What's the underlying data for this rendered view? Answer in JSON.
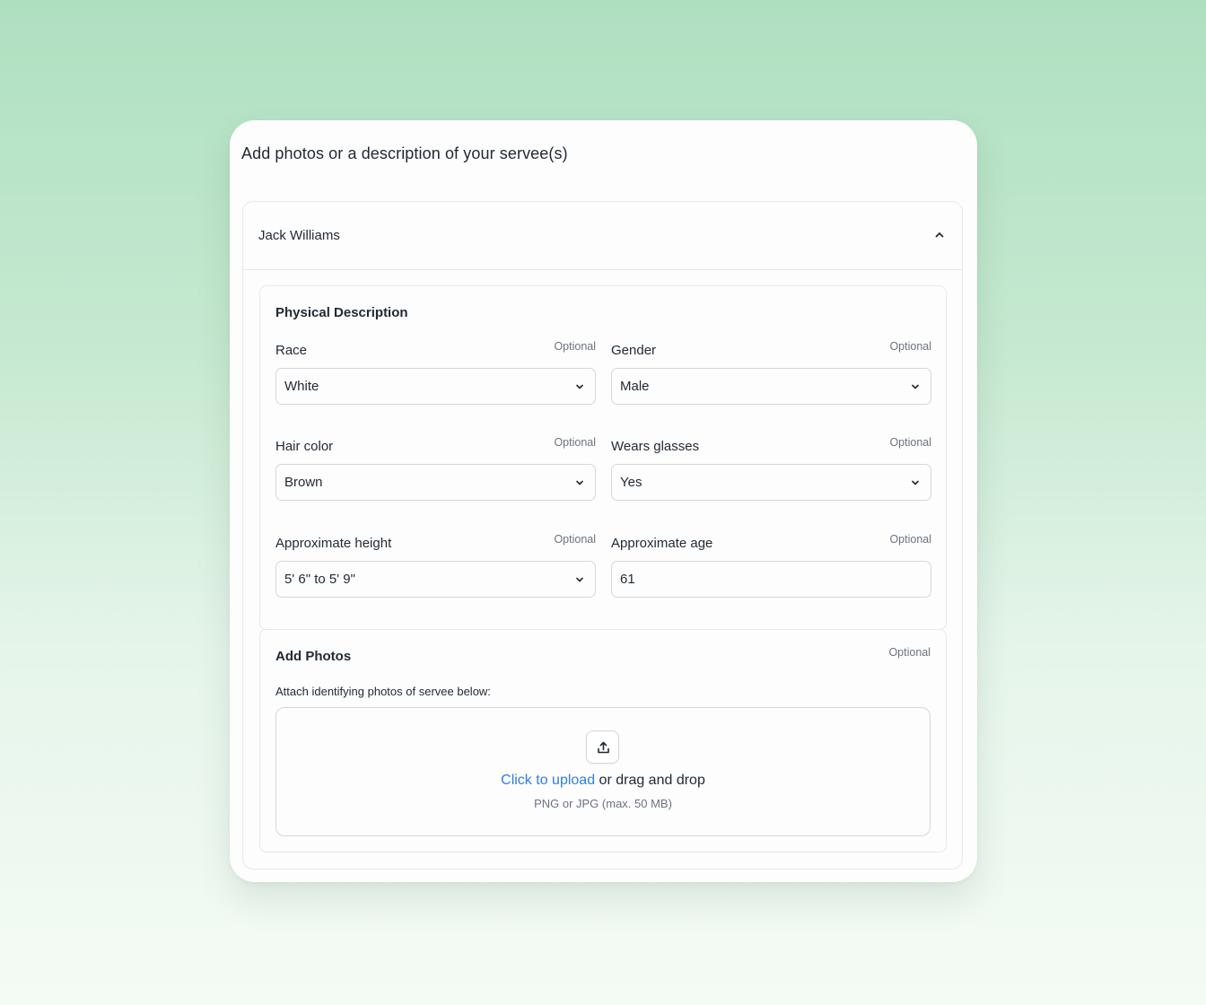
{
  "card": {
    "title": "Add photos or a description of your servee(s)"
  },
  "servee": {
    "name": "Jack Williams",
    "expanded": true
  },
  "physical_description": {
    "title": "Physical Description",
    "fields": {
      "race": {
        "label": "Race",
        "optional": "Optional",
        "value": "White"
      },
      "gender": {
        "label": "Gender",
        "optional": "Optional",
        "value": "Male"
      },
      "hair_color": {
        "label": "Hair color",
        "optional": "Optional",
        "value": "Brown"
      },
      "wears_glasses": {
        "label": "Wears glasses",
        "optional": "Optional",
        "value": "Yes"
      },
      "height": {
        "label": "Approximate height",
        "optional": "Optional",
        "value": "5' 6\" to 5' 9\""
      },
      "age": {
        "label": "Approximate age",
        "optional": "Optional",
        "value": "61"
      }
    }
  },
  "photos": {
    "title": "Add Photos",
    "optional": "Optional",
    "hint": "Attach identifying photos of servee below:",
    "upload_link": "Click to upload",
    "upload_rest": " or drag and drop",
    "upload_formats": "PNG or JPG (max. 50 MB)"
  },
  "colors": {
    "accent_link": "#2f7de1",
    "background_top": "#aee0c0",
    "background_bottom": "#f4fbf5"
  }
}
